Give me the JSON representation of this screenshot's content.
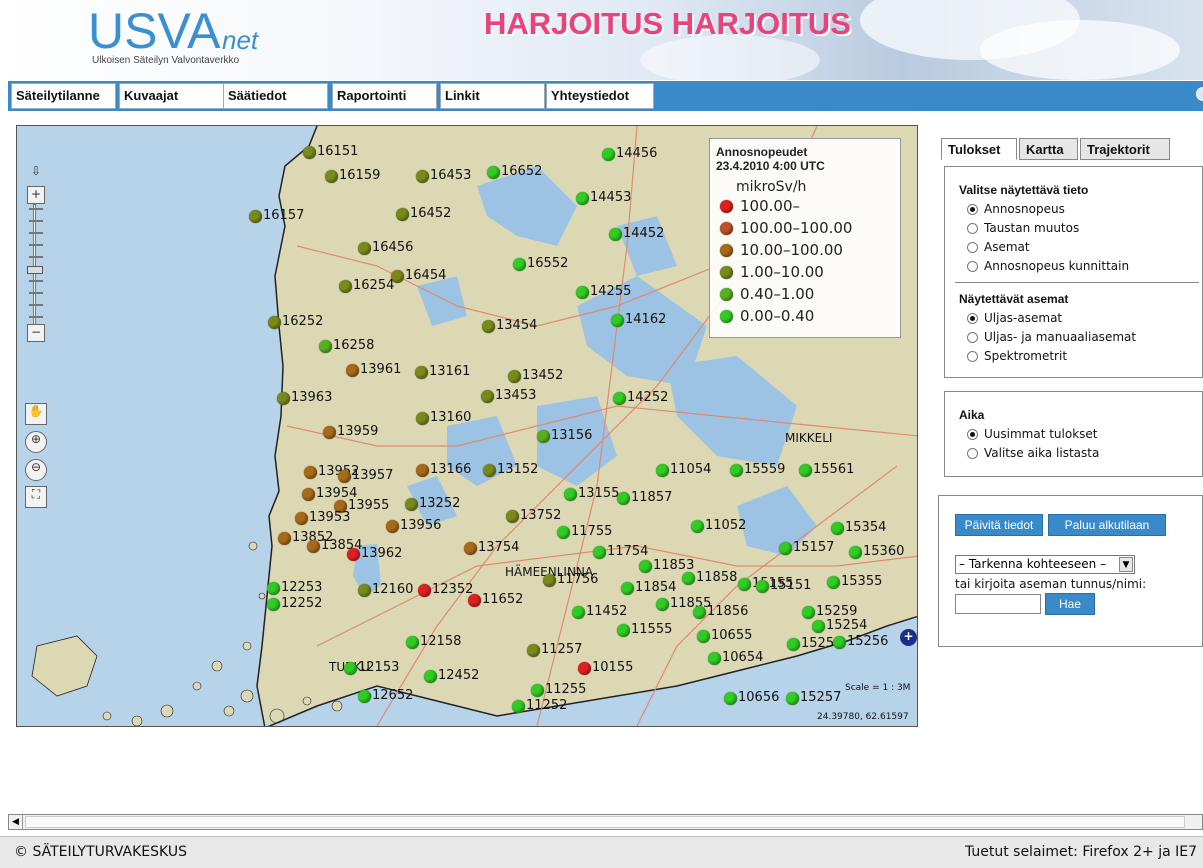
{
  "header": {
    "logo_main": "USVA",
    "logo_suffix": "net",
    "logo_subtitle": "Ulkoisen Säteilyn Valvontaverkko",
    "banner": "HARJOITUS HARJOITUS"
  },
  "nav": {
    "items": [
      {
        "label": "Säteilytilanne"
      },
      {
        "label": "Kuvaajat"
      },
      {
        "label": "Säätiedot"
      },
      {
        "label": "Raportointi"
      },
      {
        "label": "Linkit"
      },
      {
        "label": "Yhteystiedot"
      }
    ]
  },
  "map": {
    "legend": {
      "title": "Annosnopeudet",
      "timestamp": "23.4.2010 4:00 UTC",
      "unit": "mikroSv/h",
      "classes": [
        {
          "label": "100.00–",
          "color": "#e02020"
        },
        {
          "label": "100.00–100.00",
          "color": "#c05028"
        },
        {
          "label": "10.00–100.00",
          "color": "#a86a18"
        },
        {
          "label": "1.00–10.00",
          "color": "#7a8a1a"
        },
        {
          "label": "0.40–1.00",
          "color": "#58b020"
        },
        {
          "label": "0.00–0.40",
          "color": "#30cc22"
        }
      ]
    },
    "scale": "Scale = 1 : 3M",
    "coordinates": "24.39780, 62.61597",
    "places": [
      "HÄMEENLINNA",
      "TURKU",
      "MIKKELI"
    ],
    "stations": [
      {
        "id": "16151",
        "c": 3
      },
      {
        "id": "16159",
        "c": 3
      },
      {
        "id": "16453",
        "c": 3
      },
      {
        "id": "16652",
        "c": 5
      },
      {
        "id": "14456",
        "c": 5
      },
      {
        "id": "16157",
        "c": 3
      },
      {
        "id": "16452",
        "c": 3
      },
      {
        "id": "14453",
        "c": 5
      },
      {
        "id": "16456",
        "c": 3
      },
      {
        "id": "14452",
        "c": 5
      },
      {
        "id": "16552",
        "c": 5
      },
      {
        "id": "16454",
        "c": 3
      },
      {
        "id": "16254",
        "c": 3
      },
      {
        "id": "14255",
        "c": 5
      },
      {
        "id": "16252",
        "c": 3
      },
      {
        "id": "14162",
        "c": 5
      },
      {
        "id": "13454",
        "c": 3
      },
      {
        "id": "16258",
        "c": 4
      },
      {
        "id": "13961",
        "c": 2
      },
      {
        "id": "13161",
        "c": 3
      },
      {
        "id": "13452",
        "c": 3
      },
      {
        "id": "13963",
        "c": 3
      },
      {
        "id": "13453",
        "c": 3
      },
      {
        "id": "14252",
        "c": 5
      },
      {
        "id": "13160",
        "c": 3
      },
      {
        "id": "13959",
        "c": 2
      },
      {
        "id": "13156",
        "c": 4
      },
      {
        "id": "13952",
        "c": 2
      },
      {
        "id": "13957",
        "c": 2
      },
      {
        "id": "13166",
        "c": 2
      },
      {
        "id": "13152",
        "c": 3
      },
      {
        "id": "11054",
        "c": 5
      },
      {
        "id": "15559",
        "c": 5
      },
      {
        "id": "15561",
        "c": 5
      },
      {
        "id": "13954",
        "c": 2
      },
      {
        "id": "13955",
        "c": 2
      },
      {
        "id": "13252",
        "c": 3
      },
      {
        "id": "13155",
        "c": 5
      },
      {
        "id": "11857",
        "c": 5
      },
      {
        "id": "13752",
        "c": 3
      },
      {
        "id": "13953",
        "c": 2
      },
      {
        "id": "13956",
        "c": 2
      },
      {
        "id": "11755",
        "c": 5
      },
      {
        "id": "11052",
        "c": 5
      },
      {
        "id": "15354",
        "c": 5
      },
      {
        "id": "13852",
        "c": 2
      },
      {
        "id": "13854",
        "c": 2
      },
      {
        "id": "13962",
        "c": 0
      },
      {
        "id": "13754",
        "c": 2
      },
      {
        "id": "11754",
        "c": 5
      },
      {
        "id": "15157",
        "c": 5
      },
      {
        "id": "15360",
        "c": 5
      },
      {
        "id": "11853",
        "c": 5
      },
      {
        "id": "11756",
        "c": 3
      },
      {
        "id": "11858",
        "c": 5
      },
      {
        "id": "15155",
        "c": 5
      },
      {
        "id": "15151",
        "c": 5
      },
      {
        "id": "15355",
        "c": 5
      },
      {
        "id": "12253",
        "c": 5
      },
      {
        "id": "12160",
        "c": 3
      },
      {
        "id": "12352",
        "c": 0
      },
      {
        "id": "11652",
        "c": 0
      },
      {
        "id": "11854",
        "c": 5
      },
      {
        "id": "12252",
        "c": 5
      },
      {
        "id": "11855",
        "c": 5
      },
      {
        "id": "11856",
        "c": 5
      },
      {
        "id": "15259",
        "c": 5
      },
      {
        "id": "11452",
        "c": 5
      },
      {
        "id": "15254",
        "c": 5
      },
      {
        "id": "11555",
        "c": 5
      },
      {
        "id": "10655",
        "c": 5
      },
      {
        "id": "12158",
        "c": 5
      },
      {
        "id": "11257",
        "c": 3
      },
      {
        "id": "15253",
        "c": 5
      },
      {
        "id": "15256",
        "c": 5
      },
      {
        "id": "12153",
        "c": 5
      },
      {
        "id": "10155",
        "c": 0
      },
      {
        "id": "10654",
        "c": 5
      },
      {
        "id": "12452",
        "c": 5
      },
      {
        "id": "11255",
        "c": 5
      },
      {
        "id": "12652",
        "c": 5
      },
      {
        "id": "10656",
        "c": 5
      },
      {
        "id": "15257",
        "c": 5
      },
      {
        "id": "11252",
        "c": 5
      }
    ]
  },
  "tabs": [
    {
      "label": "Tulokset",
      "active": true
    },
    {
      "label": "Kartta",
      "active": false
    },
    {
      "label": "Trajektorit",
      "active": false
    }
  ],
  "panel_show": {
    "title": "Valitse näytettävä tieto",
    "options": [
      {
        "label": "Annosnopeus",
        "checked": true
      },
      {
        "label": "Taustan muutos",
        "checked": false
      },
      {
        "label": "Asemat",
        "checked": false
      },
      {
        "label": "Annosnopeus kunnittain",
        "checked": false
      }
    ],
    "stations_title": "Näytettävät asemat",
    "station_options": [
      {
        "label": "Uljas-asemat",
        "checked": true
      },
      {
        "label": "Uljas- ja manuaaliasemat",
        "checked": false
      },
      {
        "label": "Spektrometrit",
        "checked": false
      }
    ]
  },
  "panel_time": {
    "title": "Aika",
    "options": [
      {
        "label": "Uusimmat tulokset",
        "checked": true
      },
      {
        "label": "Valitse aika listasta",
        "checked": false
      }
    ]
  },
  "panel_actions": {
    "refresh_button": "Päivitä tiedot",
    "reset_button": "Paluu alkutilaan",
    "select_value": "– Tarkenna kohteeseen –",
    "search_hint": "tai kirjoita aseman tunnus/nimi:",
    "search_value": "",
    "search_button": "Hae"
  },
  "footer": {
    "left": "© SÄTEILYTURVAKESKUS",
    "right": "Tuetut selaimet: Firefox 2+ ja IE7"
  }
}
